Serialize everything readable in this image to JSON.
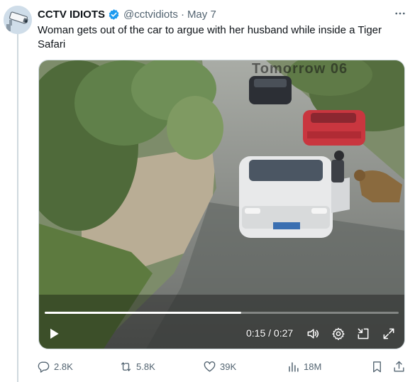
{
  "author": {
    "display_name": "CCTV IDIOTS",
    "handle": "@cctvidiots",
    "separator": "·",
    "date": "May 7",
    "avatar_icon": "cctv-camera-icon",
    "verified_color": "#1d9bf0"
  },
  "tweet": {
    "text": "Woman gets out of the car to argue with her husband while inside a Tiger Safari"
  },
  "video": {
    "current_time": "0:15",
    "duration": "0:27",
    "time_display": "0:15 / 0:27",
    "progress_fraction": 0.5556,
    "watermark_text": "Tomorrow 06"
  },
  "actions": {
    "replies": "2.8K",
    "reposts": "5.8K",
    "likes": "39K",
    "views": "18M"
  },
  "colors": {
    "text_primary": "#0f1419",
    "text_secondary": "#536471",
    "accent": "#1d9bf0",
    "border": "#cfd9de"
  }
}
